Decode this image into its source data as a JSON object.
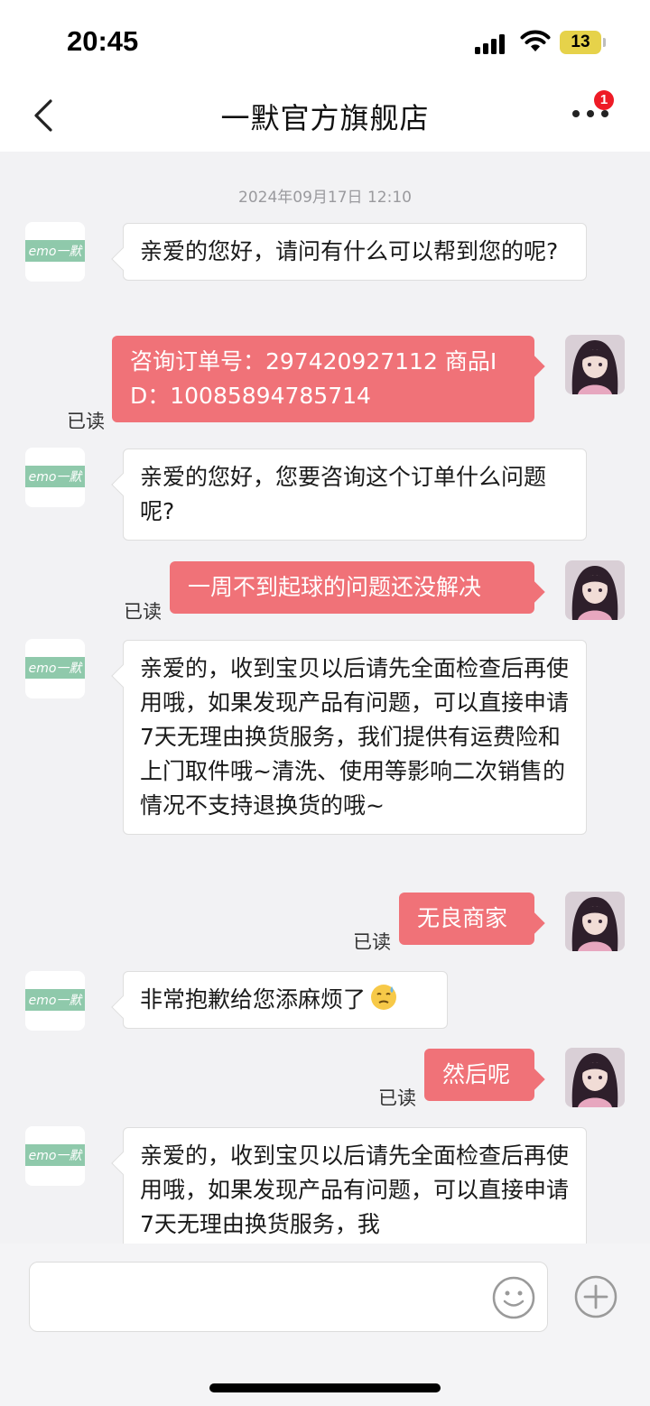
{
  "status_bar": {
    "time": "20:45",
    "battery": "13",
    "icons": [
      "signal-icon",
      "wifi-icon",
      "battery-icon"
    ]
  },
  "header": {
    "back_icon": "chevron-left-icon",
    "title": "一默官方旗舰店",
    "more_icon": "more-dots-icon",
    "more_badge": "1"
  },
  "chat": {
    "timestamp": "2024年09月17日 12:10",
    "shop_logo_text": "emo一默",
    "read_label": "已读",
    "messages": [
      {
        "from": "shop",
        "text": "亲爱的您好，请问有什么可以帮到您的呢?"
      },
      {
        "from": "user",
        "text": "咨询订单号：297420927112 商品ID：10085894785714",
        "status": "已读"
      },
      {
        "from": "shop",
        "text": "亲爱的您好，您要咨询这个订单什么问题呢?"
      },
      {
        "from": "user",
        "text": "一周不到起球的问题还没解决",
        "status": "已读"
      },
      {
        "from": "shop",
        "text": "亲爱的，收到宝贝以后请先全面检查后再使用哦，如果发现产品有问题，可以直接申请7天无理由换货服务，我们提供有运费险和上门取件哦~清洗、使用等影响二次销售的情况不支持退换货的哦~"
      },
      {
        "from": "user",
        "text": "无良商家",
        "status": "已读"
      },
      {
        "from": "shop",
        "text": "非常抱歉给您添麻烦了",
        "emoji": "sweat-emoji"
      },
      {
        "from": "user",
        "text": "然后呢",
        "status": "已读"
      },
      {
        "from": "shop",
        "text": "亲爱的，收到宝贝以后请先全面检查后再使用哦，如果发现产品有问题，可以直接申请7天无理由换货服务，我"
      }
    ]
  },
  "input_bar": {
    "placeholder": "",
    "emoji_icon": "smile-icon",
    "plus_icon": "plus-icon"
  },
  "colors": {
    "user_bubble": "#f07278",
    "shop_logo_green": "#8fc9ab",
    "badge": "#ee1b26",
    "background": "#f2f2f4"
  }
}
